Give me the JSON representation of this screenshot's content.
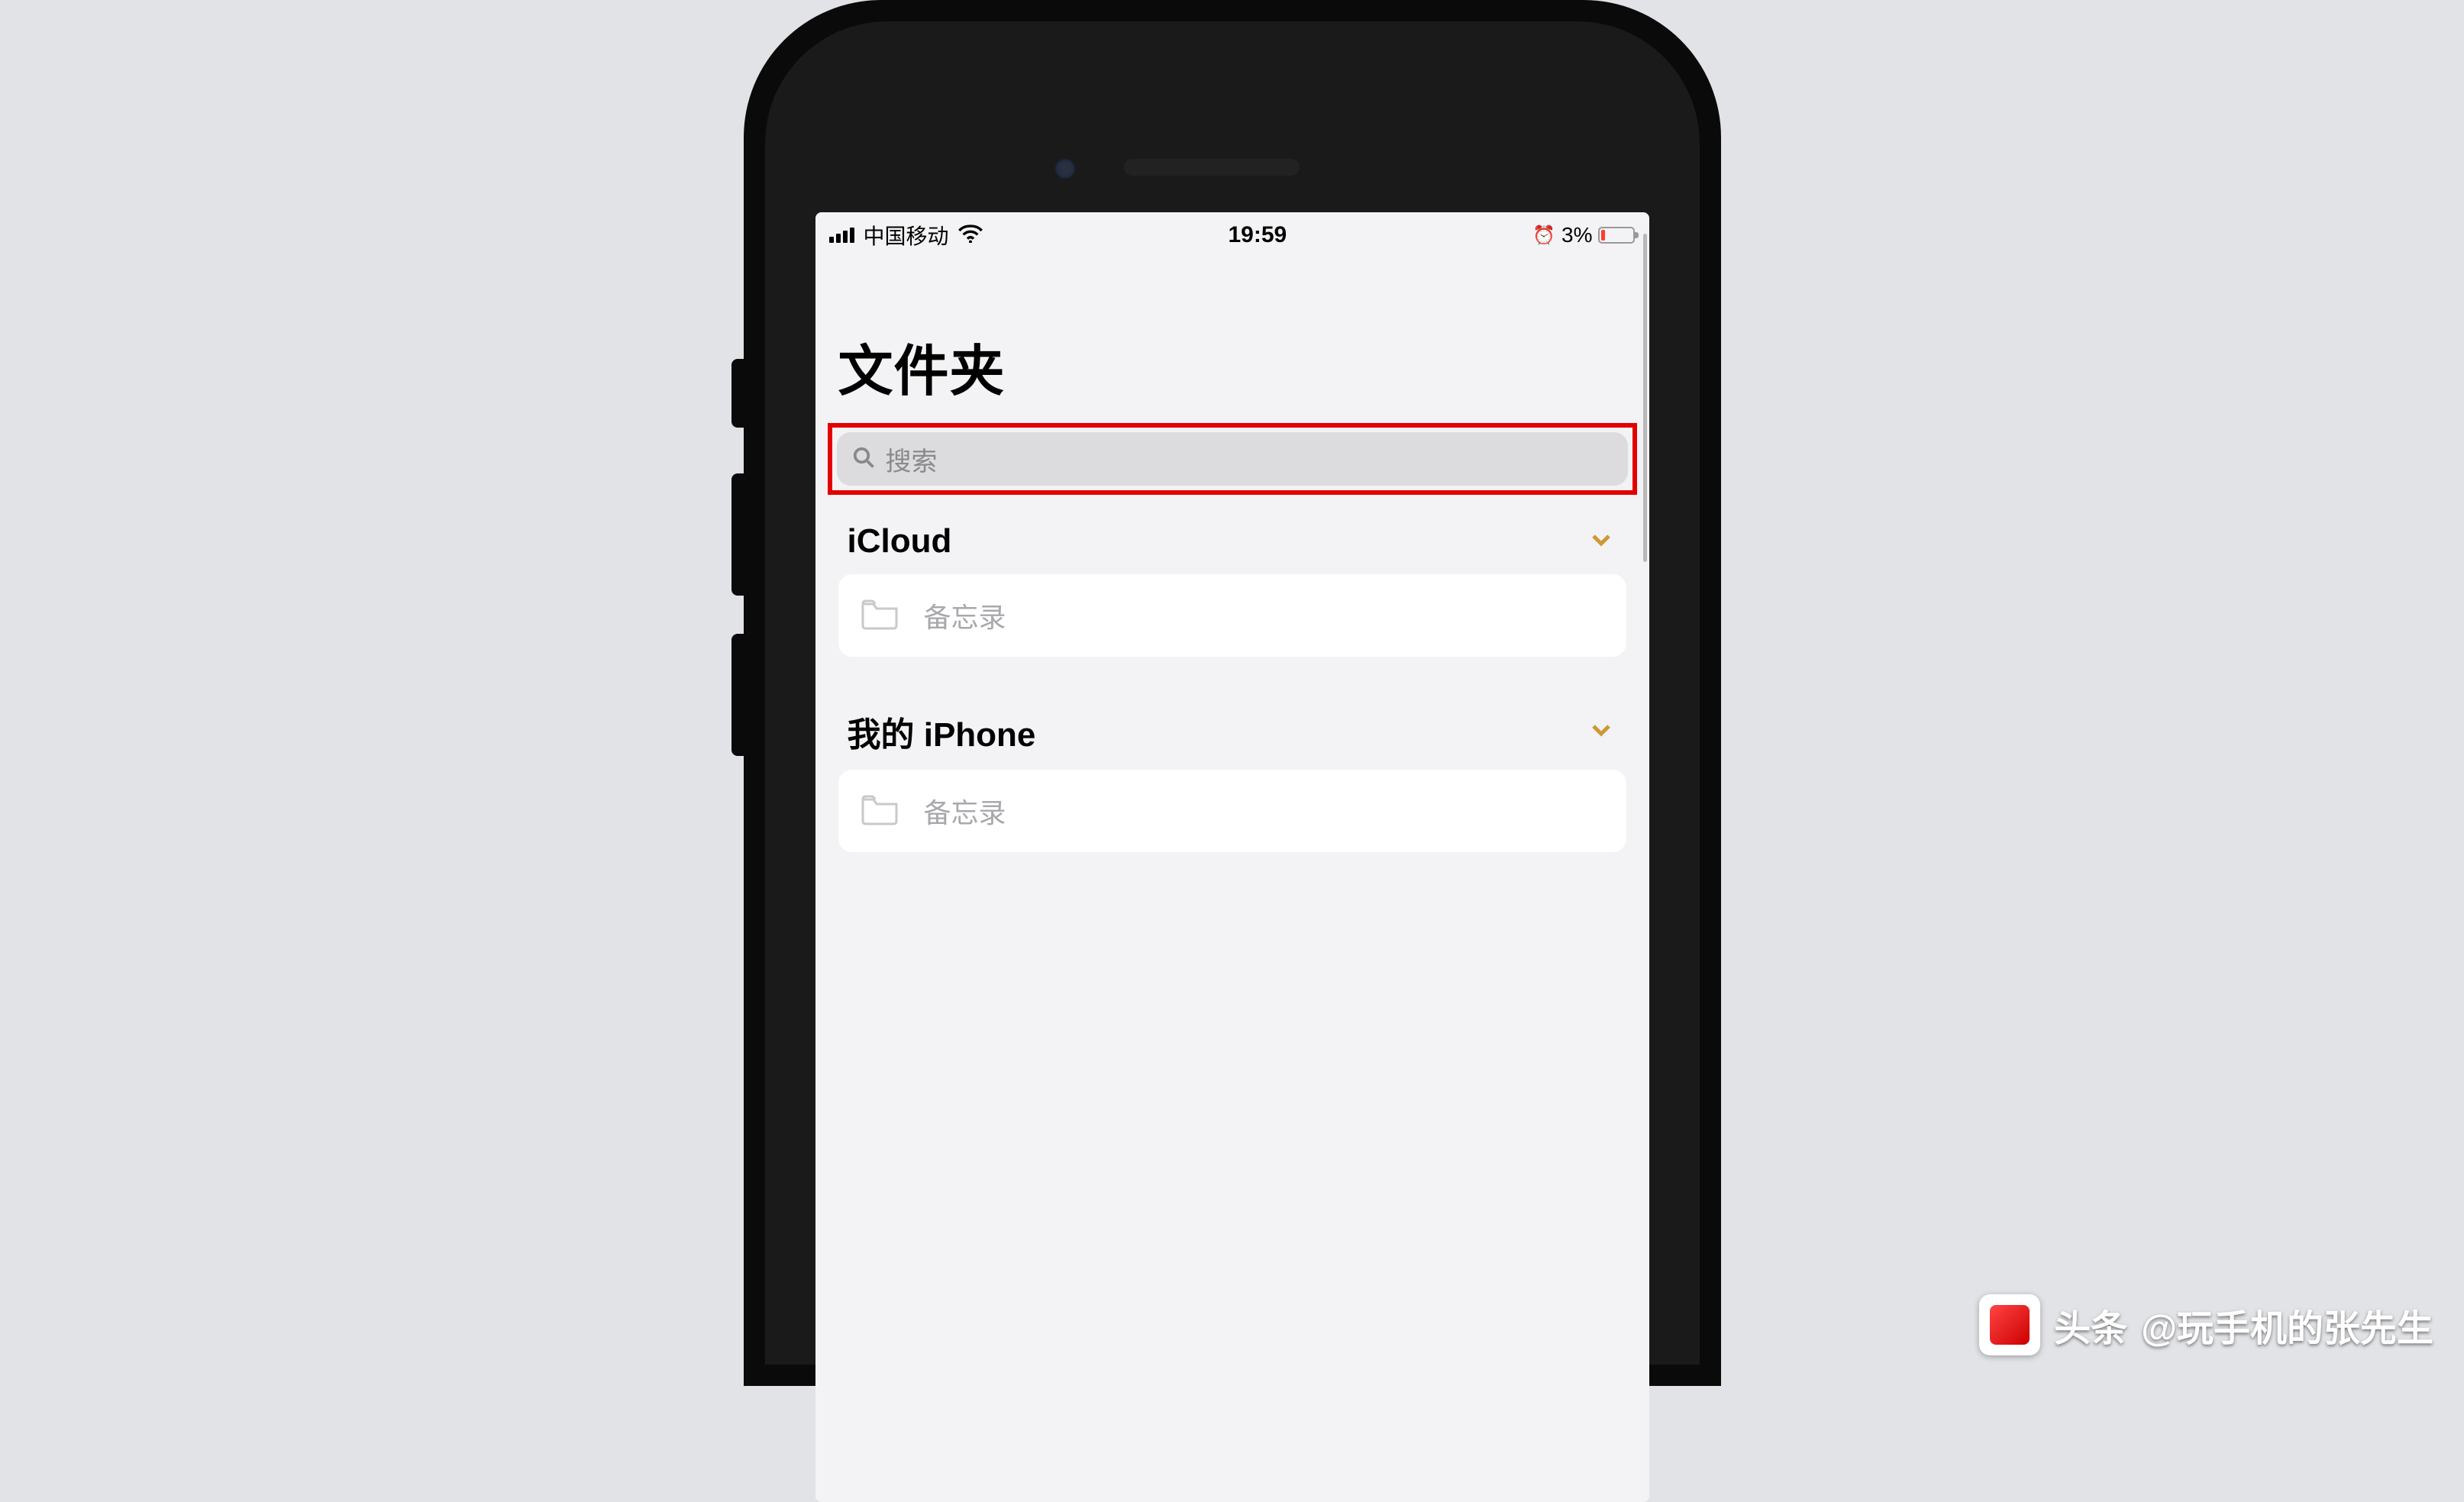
{
  "status_bar": {
    "carrier": "中国移动",
    "time": "19:59",
    "battery_percent": "3%"
  },
  "page": {
    "title": "文件夹",
    "search_placeholder": "搜索"
  },
  "sections": [
    {
      "title": "iCloud",
      "folders": [
        {
          "label": "备忘录"
        }
      ]
    },
    {
      "title": "我的 iPhone",
      "folders": [
        {
          "label": "备忘录"
        }
      ]
    }
  ],
  "watermark": {
    "brand": "头条",
    "author": "@玩手机的张先生"
  },
  "colors": {
    "accent": "#cc9933",
    "highlight_border": "#e30000",
    "battery_low": "#ff3b30"
  }
}
